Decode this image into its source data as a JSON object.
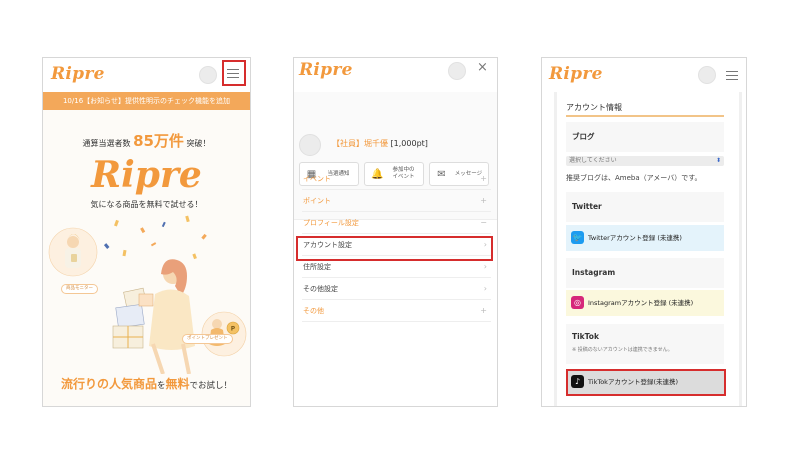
{
  "brand": {
    "logo_text": "Ripre",
    "accent": "#f2993d",
    "highlight": "#d62d2d"
  },
  "home": {
    "banner": "10/16【お知らせ】提供性明示のチェック機能を追加",
    "count_prefix": "通算当選者数",
    "count_value": "85万件",
    "count_suffix": "突破！",
    "big_logo": "Ripre",
    "tagline": "気になる商品を無料で試せる！",
    "badge_monitor": "商品モニター",
    "badge_points": "ポイントプレゼント",
    "footer_part1": "流行りの人気商品",
    "footer_part2": "を",
    "footer_part3": "無料",
    "footer_part4": "でお試し！",
    "menu_icon": "hamburger-icon"
  },
  "drawer": {
    "close_icon": "close-icon",
    "user_rank": "【社員】",
    "user_name": "堀千優",
    "user_points": "[1,000pt]",
    "quick": [
      {
        "label": "当選通知",
        "icon": "grid-icon"
      },
      {
        "label": "参加中の\nイベント",
        "icon": "bell-icon"
      },
      {
        "label": "メッセージ",
        "icon": "mail-icon"
      }
    ],
    "menu": [
      {
        "label": "イベント",
        "marker": "+"
      },
      {
        "label": "ポイント",
        "marker": "+"
      },
      {
        "label": "プロフィール設定",
        "marker": "−"
      },
      {
        "label": "アカウント設定",
        "marker": "›"
      },
      {
        "label": "住所設定",
        "marker": "›"
      },
      {
        "label": "その他設定",
        "marker": "›"
      },
      {
        "label": "その他",
        "marker": "+"
      }
    ]
  },
  "account": {
    "section_title": "アカウント情報",
    "blog_label": "ブログ",
    "select_placeholder": "選択してください",
    "blog_note": "推奨ブログは、Ameba（アメーバ）です。",
    "twitter_label": "Twitter",
    "twitter_button": "Twitterアカウント登録 (未連携)",
    "instagram_label": "Instagram",
    "instagram_button": "Instagramアカウント登録 (未連携)",
    "tiktok_label": "TikTok",
    "tiktok_note": "※ 投稿のないアカウントは連携できません。",
    "tiktok_button": "TikTokアカウント登録(未連携)",
    "twitter_color": "#1d9bf0",
    "twitter_bg": "#e4f3fb",
    "instagram_bg": "#fbf8dd",
    "tiktok_bg": "#dcdcdc"
  }
}
